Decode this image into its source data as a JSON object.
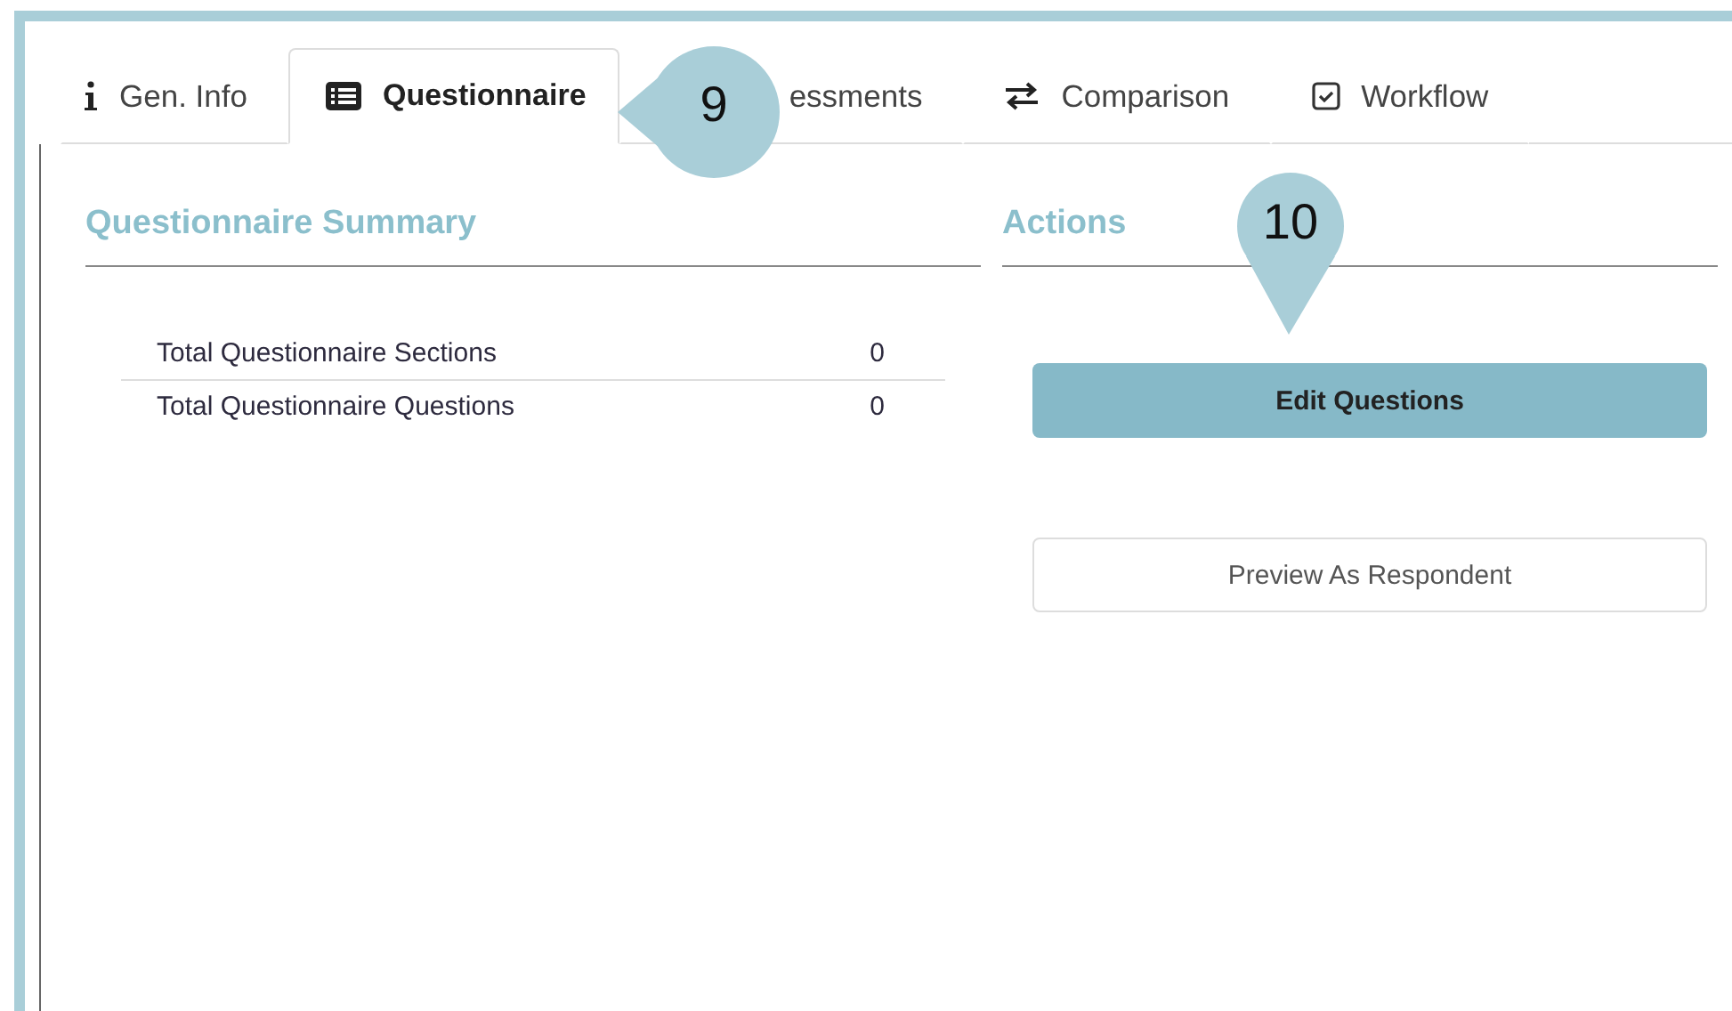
{
  "tabs": [
    {
      "label": "Gen. Info",
      "selected": false
    },
    {
      "label": "Questionnaire",
      "selected": true
    },
    {
      "label": "essments",
      "selected": false
    },
    {
      "label": "Comparison",
      "selected": false
    },
    {
      "label": "Workflow",
      "selected": false
    }
  ],
  "summary": {
    "title": "Questionnaire Summary",
    "rows": [
      {
        "label": "Total Questionnaire Sections",
        "value": "0"
      },
      {
        "label": "Total Questionnaire Questions",
        "value": "0"
      }
    ]
  },
  "actions": {
    "title": "Actions",
    "buttons": [
      {
        "label": "Edit Questions",
        "kind": "primary"
      },
      {
        "label": "Preview As Respondent",
        "kind": "secondary"
      }
    ]
  },
  "callouts": [
    {
      "number": "9",
      "kind": "left"
    },
    {
      "number": "10",
      "kind": "down"
    }
  ]
}
